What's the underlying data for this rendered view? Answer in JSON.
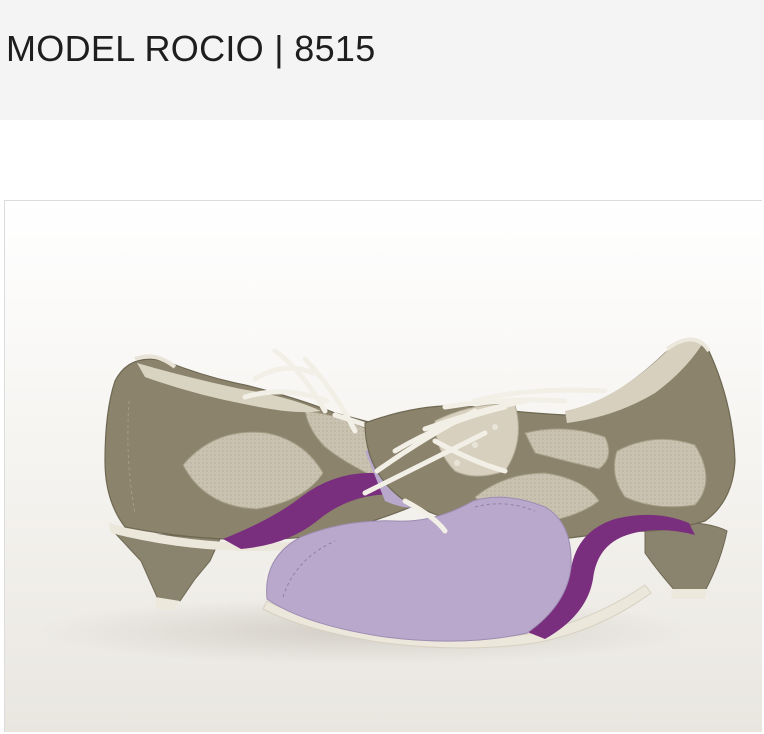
{
  "page": {
    "title": "MODEL ROCIO | 8515"
  },
  "product_image": {
    "subject": "pair of lace-up dance shoes",
    "colors": {
      "suede_taupe": "#8b836b",
      "mesh_beige": "#c7c0ad",
      "lilac": "#b9a8cc",
      "purple_stripe": "#7a2f7e",
      "laces": "#f2efe6",
      "sole": "#ebe7da"
    }
  }
}
